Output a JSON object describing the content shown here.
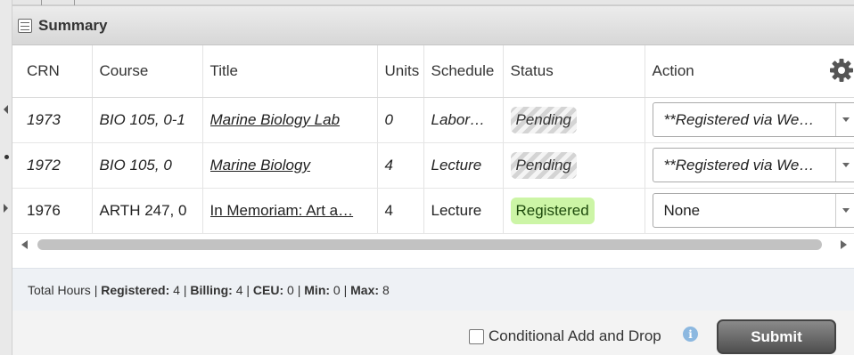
{
  "panel": {
    "title": "Summary"
  },
  "columns": {
    "crn": "CRN",
    "course": "Course",
    "title": "Title",
    "units": "Units",
    "schedule": "Schedule",
    "status": "Status",
    "action": "Action"
  },
  "rows": [
    {
      "crn": "1973",
      "course": "BIO 105, 0-1",
      "title": "Marine Biology Lab",
      "units": "0",
      "schedule": "Labor…",
      "status": "Pending",
      "action": "**Registered via We…"
    },
    {
      "crn": "1972",
      "course": "BIO 105, 0",
      "title": "Marine Biology",
      "units": "4",
      "schedule": "Lecture",
      "status": "Pending",
      "action": "**Registered via We…"
    },
    {
      "crn": "1976",
      "course": "ARTH 247, 0",
      "title": "In Memoriam: Art a…",
      "units": "4",
      "schedule": "Lecture",
      "status": "Registered",
      "action": "None"
    }
  ],
  "totals": {
    "prefix": "Total Hours | ",
    "registered_label": "Registered:",
    "registered": "4",
    "billing_label": "Billing:",
    "billing": "4",
    "ceu_label": "CEU:",
    "ceu": "0",
    "min_label": "Min:",
    "min": "0",
    "max_label": "Max:",
    "max": "8"
  },
  "bottom": {
    "conditional_label": "Conditional Add and Drop",
    "info_glyph": "i",
    "submit_label": "Submit"
  },
  "colors": {
    "pending_stripe": "#d4d4d4",
    "registered_badge": "#ccf5a6",
    "footer_band": "#eef1f5",
    "submit_button": "#5f5f5f"
  },
  "icons": [
    "summary-icon",
    "gear-icon",
    "info-icon",
    "chevron-down-icon",
    "scroll-left-icon",
    "scroll-right-icon"
  ]
}
